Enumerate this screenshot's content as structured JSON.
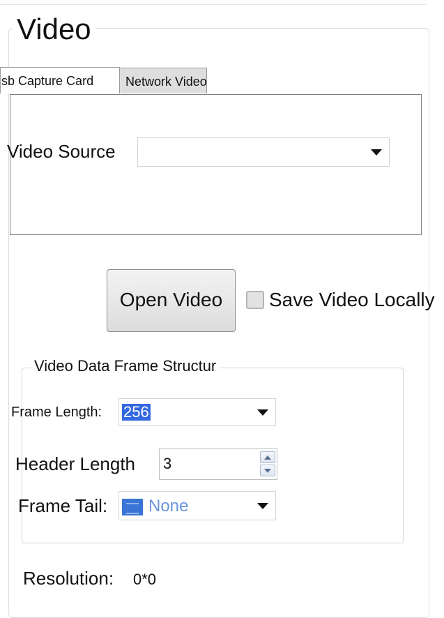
{
  "group": {
    "title": "Video"
  },
  "tabs": [
    {
      "label": "usb Capture Card",
      "active": true
    },
    {
      "label": "Network Video",
      "active": false
    }
  ],
  "video_source": {
    "label": "Video Source",
    "value": ""
  },
  "open_button": {
    "label": "Open Video"
  },
  "save_locally": {
    "label": "Save Video Locally",
    "checked": false
  },
  "frame_structure": {
    "title": "Video Data Frame Structur",
    "frame_length": {
      "label": "Frame Length:",
      "value": "256"
    },
    "header_length": {
      "label": "Header Length",
      "value": "3"
    },
    "frame_tail": {
      "label": "Frame Tail:",
      "value": "None"
    }
  },
  "resolution": {
    "label": "Resolution:",
    "value": "0*0"
  }
}
